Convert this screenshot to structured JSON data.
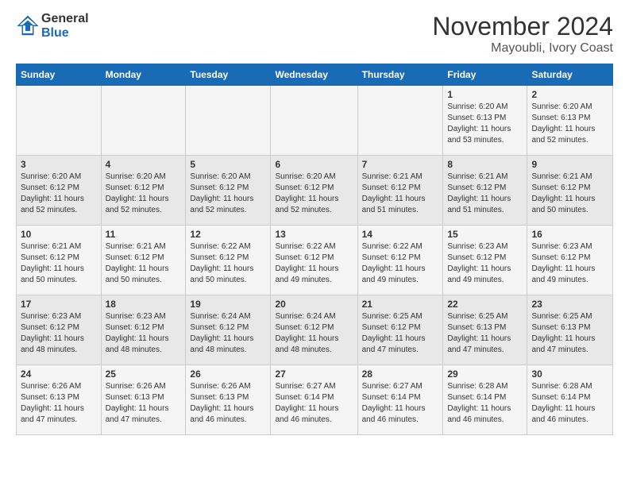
{
  "logo": {
    "line1": "General",
    "line2": "Blue"
  },
  "title": "November 2024",
  "subtitle": "Mayoubli, Ivory Coast",
  "header_days": [
    "Sunday",
    "Monday",
    "Tuesday",
    "Wednesday",
    "Thursday",
    "Friday",
    "Saturday"
  ],
  "weeks": [
    {
      "days": [
        {
          "num": "",
          "info": ""
        },
        {
          "num": "",
          "info": ""
        },
        {
          "num": "",
          "info": ""
        },
        {
          "num": "",
          "info": ""
        },
        {
          "num": "",
          "info": ""
        },
        {
          "num": "1",
          "info": "Sunrise: 6:20 AM\nSunset: 6:13 PM\nDaylight: 11 hours\nand 53 minutes."
        },
        {
          "num": "2",
          "info": "Sunrise: 6:20 AM\nSunset: 6:13 PM\nDaylight: 11 hours\nand 52 minutes."
        }
      ]
    },
    {
      "days": [
        {
          "num": "3",
          "info": "Sunrise: 6:20 AM\nSunset: 6:12 PM\nDaylight: 11 hours\nand 52 minutes."
        },
        {
          "num": "4",
          "info": "Sunrise: 6:20 AM\nSunset: 6:12 PM\nDaylight: 11 hours\nand 52 minutes."
        },
        {
          "num": "5",
          "info": "Sunrise: 6:20 AM\nSunset: 6:12 PM\nDaylight: 11 hours\nand 52 minutes."
        },
        {
          "num": "6",
          "info": "Sunrise: 6:20 AM\nSunset: 6:12 PM\nDaylight: 11 hours\nand 52 minutes."
        },
        {
          "num": "7",
          "info": "Sunrise: 6:21 AM\nSunset: 6:12 PM\nDaylight: 11 hours\nand 51 minutes."
        },
        {
          "num": "8",
          "info": "Sunrise: 6:21 AM\nSunset: 6:12 PM\nDaylight: 11 hours\nand 51 minutes."
        },
        {
          "num": "9",
          "info": "Sunrise: 6:21 AM\nSunset: 6:12 PM\nDaylight: 11 hours\nand 50 minutes."
        }
      ]
    },
    {
      "days": [
        {
          "num": "10",
          "info": "Sunrise: 6:21 AM\nSunset: 6:12 PM\nDaylight: 11 hours\nand 50 minutes."
        },
        {
          "num": "11",
          "info": "Sunrise: 6:21 AM\nSunset: 6:12 PM\nDaylight: 11 hours\nand 50 minutes."
        },
        {
          "num": "12",
          "info": "Sunrise: 6:22 AM\nSunset: 6:12 PM\nDaylight: 11 hours\nand 50 minutes."
        },
        {
          "num": "13",
          "info": "Sunrise: 6:22 AM\nSunset: 6:12 PM\nDaylight: 11 hours\nand 49 minutes."
        },
        {
          "num": "14",
          "info": "Sunrise: 6:22 AM\nSunset: 6:12 PM\nDaylight: 11 hours\nand 49 minutes."
        },
        {
          "num": "15",
          "info": "Sunrise: 6:23 AM\nSunset: 6:12 PM\nDaylight: 11 hours\nand 49 minutes."
        },
        {
          "num": "16",
          "info": "Sunrise: 6:23 AM\nSunset: 6:12 PM\nDaylight: 11 hours\nand 49 minutes."
        }
      ]
    },
    {
      "days": [
        {
          "num": "17",
          "info": "Sunrise: 6:23 AM\nSunset: 6:12 PM\nDaylight: 11 hours\nand 48 minutes."
        },
        {
          "num": "18",
          "info": "Sunrise: 6:23 AM\nSunset: 6:12 PM\nDaylight: 11 hours\nand 48 minutes."
        },
        {
          "num": "19",
          "info": "Sunrise: 6:24 AM\nSunset: 6:12 PM\nDaylight: 11 hours\nand 48 minutes."
        },
        {
          "num": "20",
          "info": "Sunrise: 6:24 AM\nSunset: 6:12 PM\nDaylight: 11 hours\nand 48 minutes."
        },
        {
          "num": "21",
          "info": "Sunrise: 6:25 AM\nSunset: 6:12 PM\nDaylight: 11 hours\nand 47 minutes."
        },
        {
          "num": "22",
          "info": "Sunrise: 6:25 AM\nSunset: 6:13 PM\nDaylight: 11 hours\nand 47 minutes."
        },
        {
          "num": "23",
          "info": "Sunrise: 6:25 AM\nSunset: 6:13 PM\nDaylight: 11 hours\nand 47 minutes."
        }
      ]
    },
    {
      "days": [
        {
          "num": "24",
          "info": "Sunrise: 6:26 AM\nSunset: 6:13 PM\nDaylight: 11 hours\nand 47 minutes."
        },
        {
          "num": "25",
          "info": "Sunrise: 6:26 AM\nSunset: 6:13 PM\nDaylight: 11 hours\nand 47 minutes."
        },
        {
          "num": "26",
          "info": "Sunrise: 6:26 AM\nSunset: 6:13 PM\nDaylight: 11 hours\nand 46 minutes."
        },
        {
          "num": "27",
          "info": "Sunrise: 6:27 AM\nSunset: 6:14 PM\nDaylight: 11 hours\nand 46 minutes."
        },
        {
          "num": "28",
          "info": "Sunrise: 6:27 AM\nSunset: 6:14 PM\nDaylight: 11 hours\nand 46 minutes."
        },
        {
          "num": "29",
          "info": "Sunrise: 6:28 AM\nSunset: 6:14 PM\nDaylight: 11 hours\nand 46 minutes."
        },
        {
          "num": "30",
          "info": "Sunrise: 6:28 AM\nSunset: 6:14 PM\nDaylight: 11 hours\nand 46 minutes."
        }
      ]
    }
  ]
}
